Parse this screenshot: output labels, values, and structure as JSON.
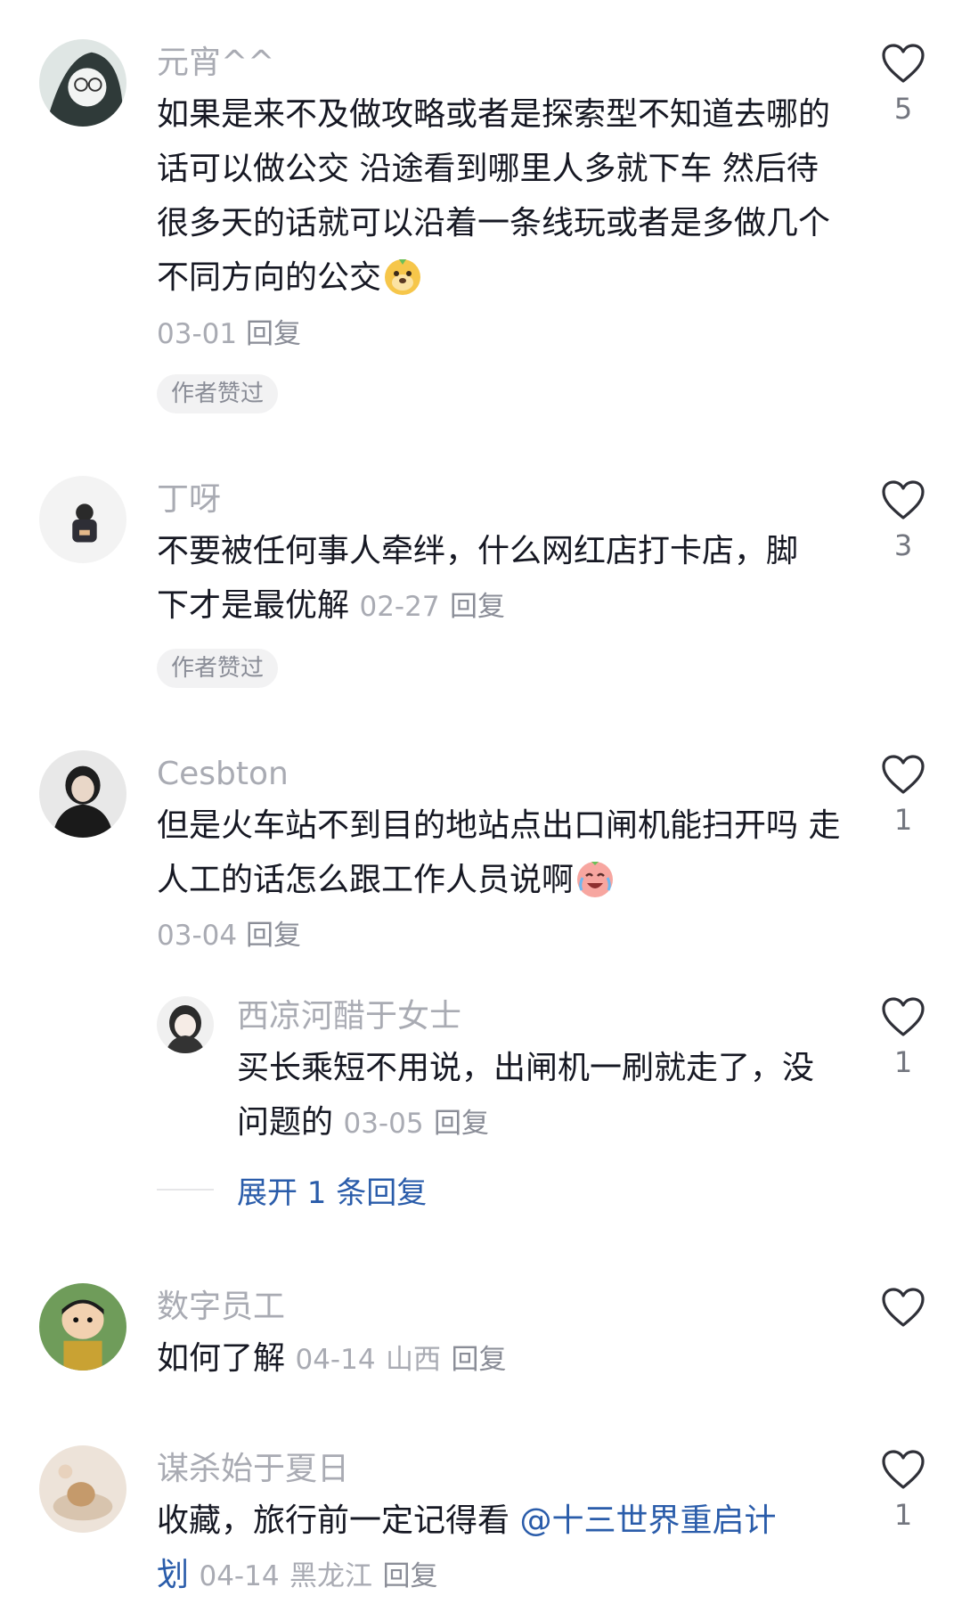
{
  "comments": [
    {
      "username": "元宵^^",
      "text": "如果是来不及做攻略或者是探索型不知道去哪的话可以做公交 沿途看到哪里人多就下车 然后待很多天的话就可以沿着一条线玩或者是多做几个不同方向的公交",
      "date": "03-01",
      "reply_label": "回复",
      "badge": "作者赞过",
      "likes": "5",
      "emoji": "doge-emoji"
    },
    {
      "username": "丁呀",
      "text": "不要被任何事人牵绊，什么网红店打卡店，脚下才是最优解",
      "date": "02-27",
      "reply_label": "回复",
      "badge": "作者赞过",
      "likes": "3"
    },
    {
      "username": "Cesbton",
      "text": "但是火车站不到目的地站点出口闸机能扫开吗 走人工的话怎么跟工作人员说啊",
      "date": "03-04",
      "reply_label": "回复",
      "likes": "1",
      "emoji": "cry-laugh-emoji"
    },
    {
      "username": "数字员工",
      "text": "如何了解",
      "date": "04-14",
      "location": "山西",
      "reply_label": "回复",
      "likes": ""
    },
    {
      "username": "谋杀始于夏日",
      "text": "收藏，旅行前一定记得看 ",
      "mention": "@十三世界重启计划",
      "date": "04-14",
      "location": "黑龙江",
      "reply_label": "回复",
      "likes": "1"
    }
  ],
  "reply": {
    "username": "西凉河醋于女士",
    "text": "买长乘短不用说，出闸机一刷就走了，没问题的",
    "date": "03-05",
    "reply_label": "回复",
    "likes": "1"
  },
  "expand_replies": "展开 1 条回复",
  "colors": {
    "username": "#a9abb3",
    "text": "#161823",
    "mention": "#2a5caa",
    "badge_bg": "#f2f2f3"
  }
}
